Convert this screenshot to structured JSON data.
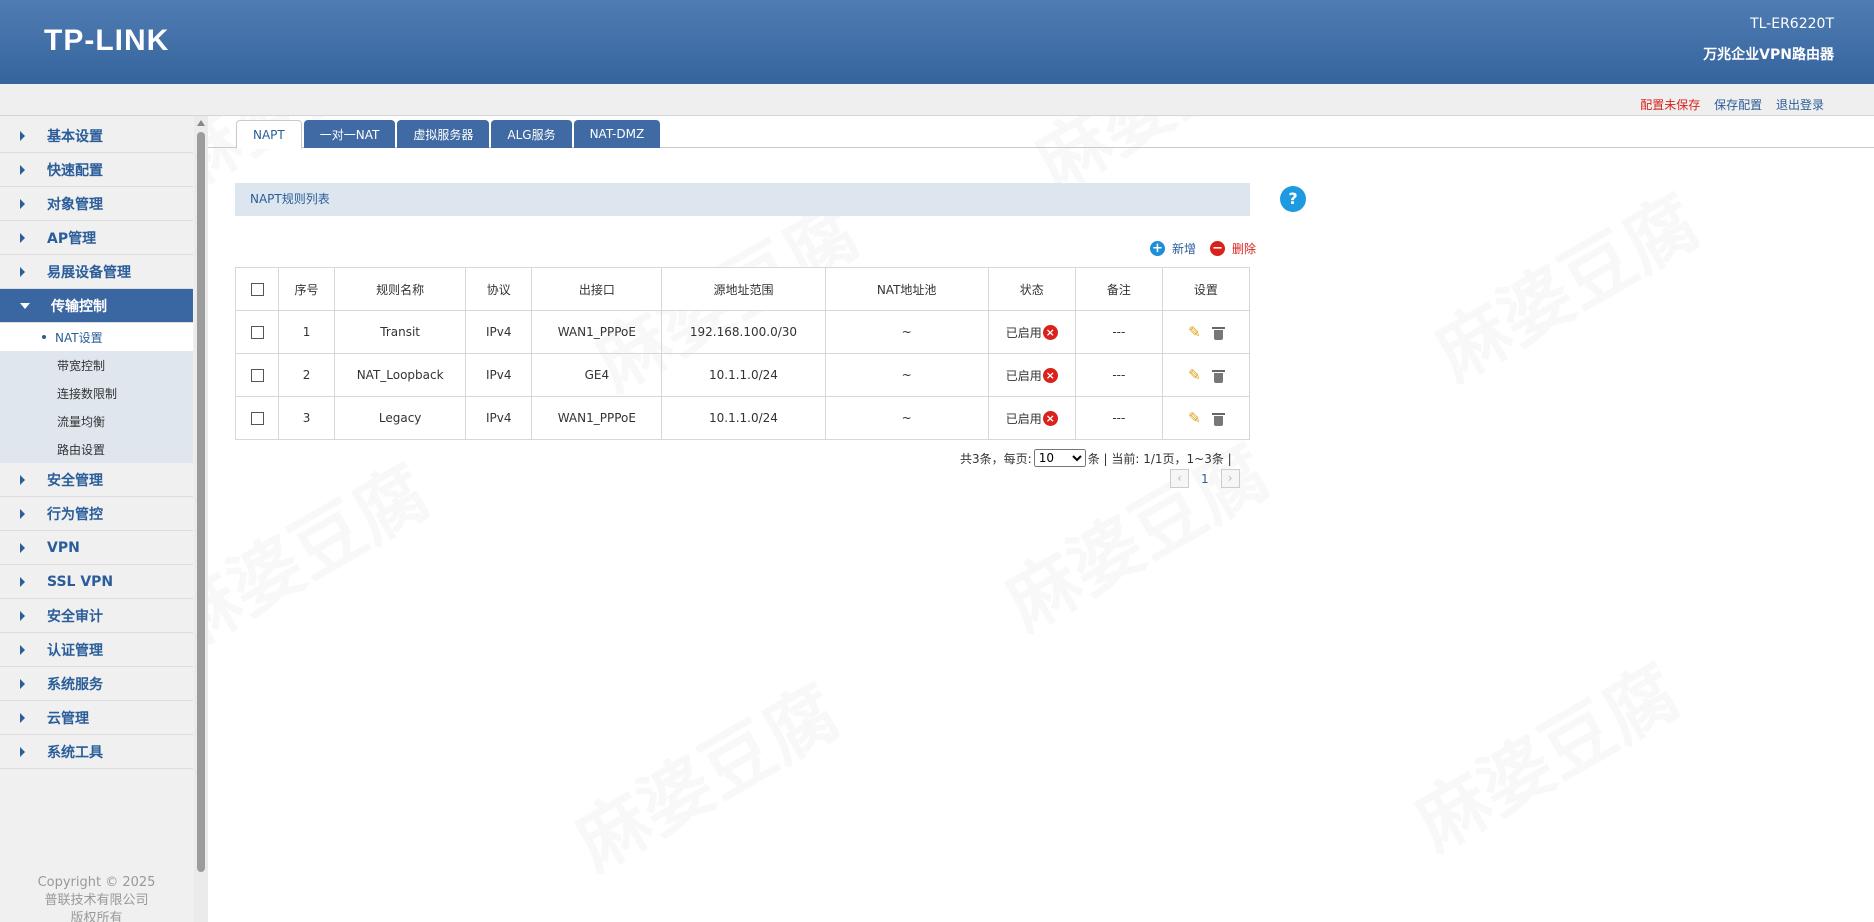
{
  "header": {
    "logo": "TP-LINK",
    "model": "TL-ER6220T",
    "product": "万兆企业VPN路由器"
  },
  "topbar": {
    "unsaved": "配置未保存",
    "save": "保存配置",
    "logout": "退出登录"
  },
  "sidebar": {
    "items": [
      {
        "label": "基本设置"
      },
      {
        "label": "快速配置"
      },
      {
        "label": "对象管理"
      },
      {
        "label": "AP管理"
      },
      {
        "label": "易展设备管理"
      },
      {
        "label": "传输控制"
      },
      {
        "label": "安全管理"
      },
      {
        "label": "行为管控"
      },
      {
        "label": "VPN"
      },
      {
        "label": "SSL VPN"
      },
      {
        "label": "安全审计"
      },
      {
        "label": "认证管理"
      },
      {
        "label": "系统服务"
      },
      {
        "label": "云管理"
      },
      {
        "label": "系统工具"
      }
    ],
    "submenu": [
      {
        "label": "NAT设置"
      },
      {
        "label": "带宽控制"
      },
      {
        "label": "连接数限制"
      },
      {
        "label": "流量均衡"
      },
      {
        "label": "路由设置"
      }
    ],
    "copyright": [
      "Copyright © 2025",
      "普联技术有限公司",
      "版权所有"
    ]
  },
  "tabs": [
    "NAPT",
    "一对一NAT",
    "虚拟服务器",
    "ALG服务",
    "NAT-DMZ"
  ],
  "panel": {
    "title": "NAPT规则列表",
    "add": "新增",
    "delete": "删除"
  },
  "table": {
    "headers": [
      "序号",
      "规则名称",
      "协议",
      "出接口",
      "源地址范围",
      "NAT地址池",
      "状态",
      "备注",
      "设置"
    ],
    "rows": [
      {
        "id": "1",
        "name": "Transit",
        "protocol": "IPv4",
        "iface": "WAN1_PPPoE",
        "src": "192.168.100.0/30",
        "pool": "~",
        "status": "已启用",
        "note": "---"
      },
      {
        "id": "2",
        "name": "NAT_Loopback",
        "protocol": "IPv4",
        "iface": "GE4",
        "src": "10.1.1.0/24",
        "pool": "~",
        "status": "已启用",
        "note": "---"
      },
      {
        "id": "3",
        "name": "Legacy",
        "protocol": "IPv4",
        "iface": "WAN1_PPPoE",
        "src": "10.1.1.0/24",
        "pool": "~",
        "status": "已启用",
        "note": "---"
      }
    ]
  },
  "pager": {
    "total_prefix": "共3条，每页:",
    "per_page": "10",
    "suffix": "条 | 当前: 1/1页，1~3条 |",
    "page": "1"
  },
  "watermark": "麻婆豆腐",
  "colors": {
    "header_blue": "#3a67a1",
    "link_blue": "#2a5d99",
    "alert_red": "#d9221c",
    "help_blue": "#1e9be0"
  }
}
